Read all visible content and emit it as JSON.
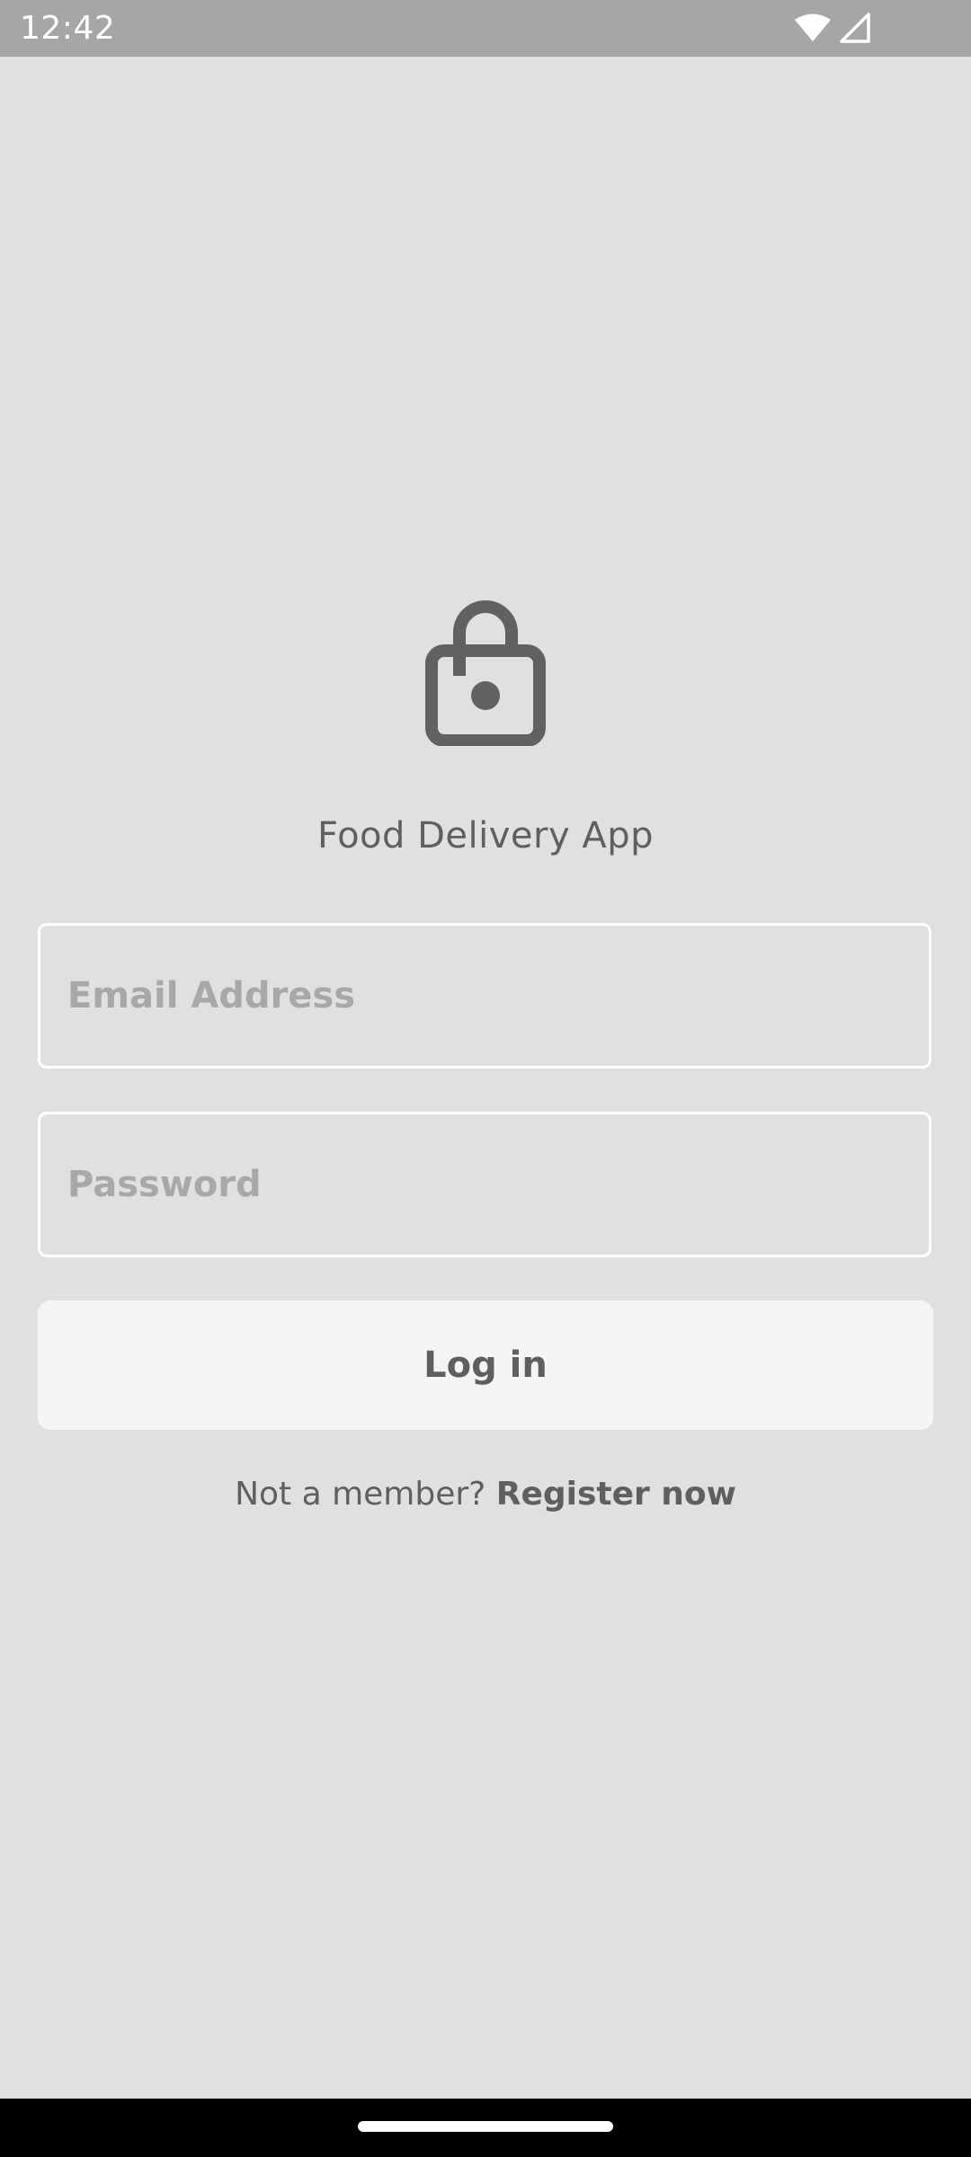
{
  "status_bar": {
    "time": "12:42",
    "icons": [
      "wifi-icon",
      "signal-icon"
    ]
  },
  "app": {
    "icon": "lock-open-icon",
    "title": "Food Delivery App"
  },
  "form": {
    "email_placeholder": "Email Address",
    "email_value": "",
    "password_placeholder": "Password",
    "password_value": "",
    "login_label": "Log in"
  },
  "register": {
    "prompt": "Not a member? ",
    "link_label": "Register now"
  },
  "colors": {
    "background": "#e0e0e0",
    "status_bar": "#a6a6a6",
    "text": "#5f5f5f",
    "placeholder": "#a8a8a8",
    "button": "#f5f5f5",
    "field_border": "#ffffff",
    "nav_bar": "#000000"
  }
}
